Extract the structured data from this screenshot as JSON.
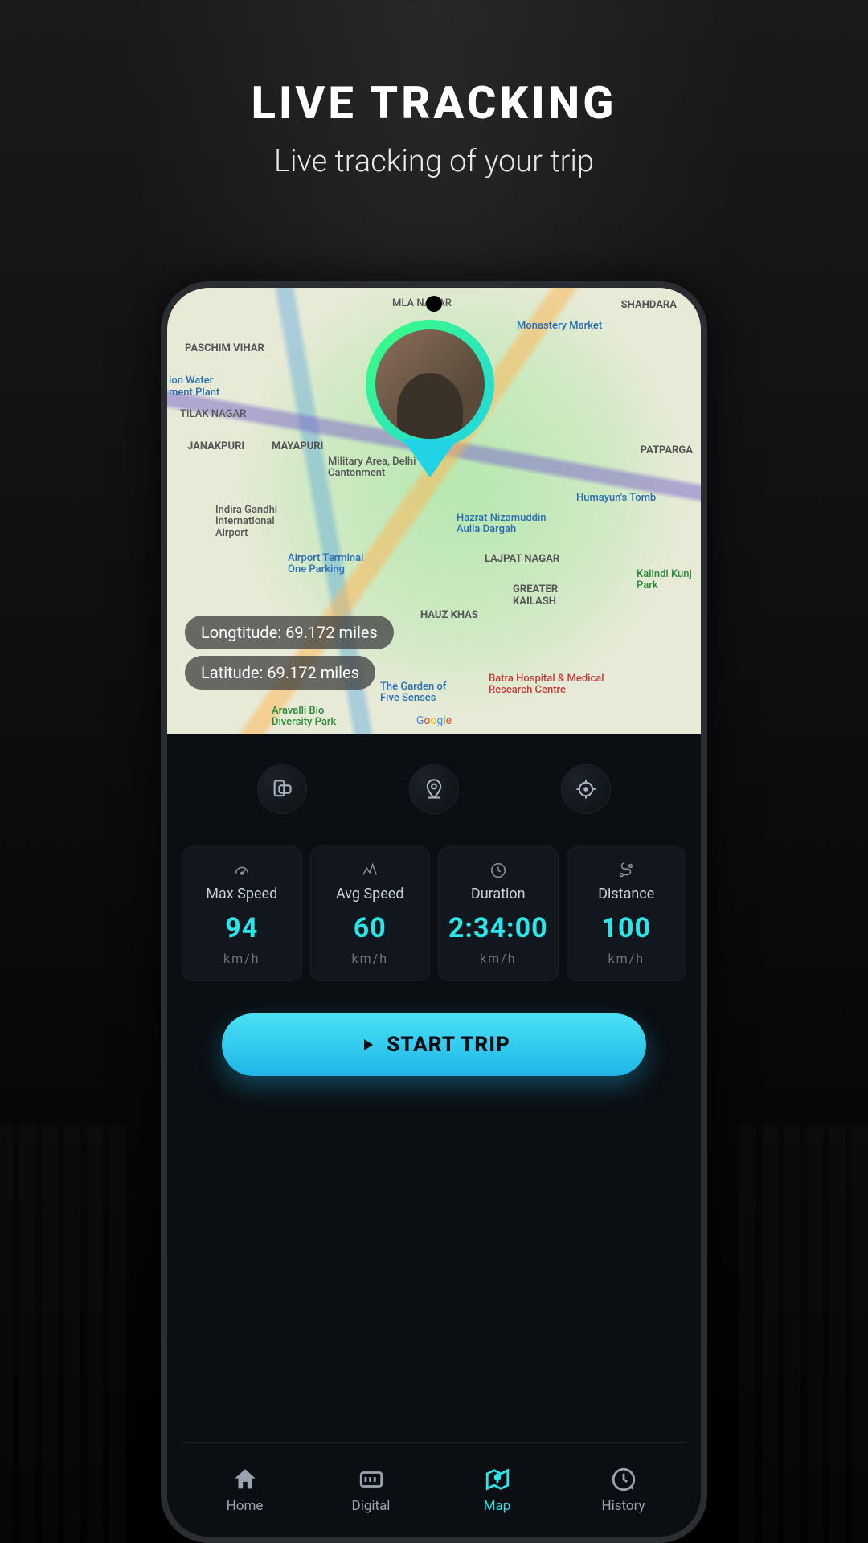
{
  "hero": {
    "title": "LIVE TRACKING",
    "subtitle": "Live tracking of your trip"
  },
  "map": {
    "longitude_label": "Longtitude: 69.172 miles",
    "latitude_label": "Latitude: 69.172 miles",
    "attribution": "Google",
    "places": [
      "MLA NAGAR",
      "SHAHDARA",
      "Monastery Market",
      "PASCHIM VIHAR",
      "JANAKPURI",
      "MAYAPURI",
      "Military Area, Delhi Cantonment",
      "Indira Gandhi International Airport",
      "Airport Terminal One Parking",
      "Hazrat Nizamuddin Aulia Dargah",
      "Humayun's Tomb",
      "LAJPAT NAGAR",
      "GREATER KAILASH",
      "HAUZ KHAS",
      "The Garden of Five Senses",
      "Batra Hospital & Medical Research Centre",
      "Aravalli Bio Diversity Park",
      "Kalindi Kunj Park",
      "PATPARGA",
      "ion Water ment Plant",
      "TILAK NAGAR"
    ]
  },
  "actions": {
    "orientation": "orientation",
    "location": "location",
    "center": "center"
  },
  "stats": [
    {
      "label": "Max Speed",
      "value": "94",
      "unit": "km/h",
      "icon": "gauge"
    },
    {
      "label": "Avg Speed",
      "value": "60",
      "unit": "km/h",
      "icon": "avg"
    },
    {
      "label": "Duration",
      "value": "2:34:00",
      "unit": "km/h",
      "icon": "clock"
    },
    {
      "label": "Distance",
      "value": "100",
      "unit": "km/h",
      "icon": "route"
    }
  ],
  "start_button": "START TRIP",
  "nav": [
    {
      "label": "Home",
      "active": false
    },
    {
      "label": "Digital",
      "active": false
    },
    {
      "label": "Map",
      "active": true
    },
    {
      "label": "History",
      "active": false
    }
  ],
  "colors": {
    "accent": "#2be5e9",
    "button": "#2fc6ee"
  }
}
